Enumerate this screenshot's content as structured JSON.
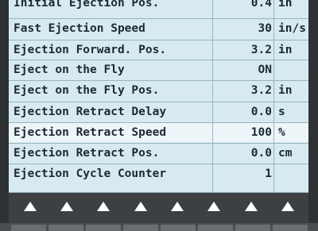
{
  "rows": [
    {
      "label": "Initial Ejection Pos.",
      "value": "0.4",
      "unit": "in"
    },
    {
      "label": "Fast Ejection Speed",
      "value": "30",
      "unit": "in/s"
    },
    {
      "label": "Ejection Forward. Pos.",
      "value": "3.2",
      "unit": "in"
    },
    {
      "label": "Eject on the Fly",
      "value": "ON",
      "unit": ""
    },
    {
      "label": "Eject on the Fly Pos.",
      "value": "3.2",
      "unit": "in"
    },
    {
      "label": "Ejection Retract Delay",
      "value": "0.0",
      "unit": "s"
    },
    {
      "label": "Ejection Retract Speed",
      "value": "100",
      "unit": "%"
    },
    {
      "label": "Ejection Retract Pos.",
      "value": "0.0",
      "unit": "cm"
    },
    {
      "label": "Ejection Cycle Counter",
      "value": "1",
      "unit": ""
    }
  ],
  "softkeys": [
    "up-arrow-icon",
    "up-arrow-icon",
    "up-arrow-icon",
    "up-arrow-icon",
    "up-arrow-icon",
    "up-arrow-icon",
    "up-arrow-icon",
    "up-arrow-icon"
  ],
  "colors": {
    "screen_bg": "#d7eaf2",
    "selected_row": "#eef5f8",
    "text": "#1c2a33",
    "bezel": "#3c4043"
  }
}
